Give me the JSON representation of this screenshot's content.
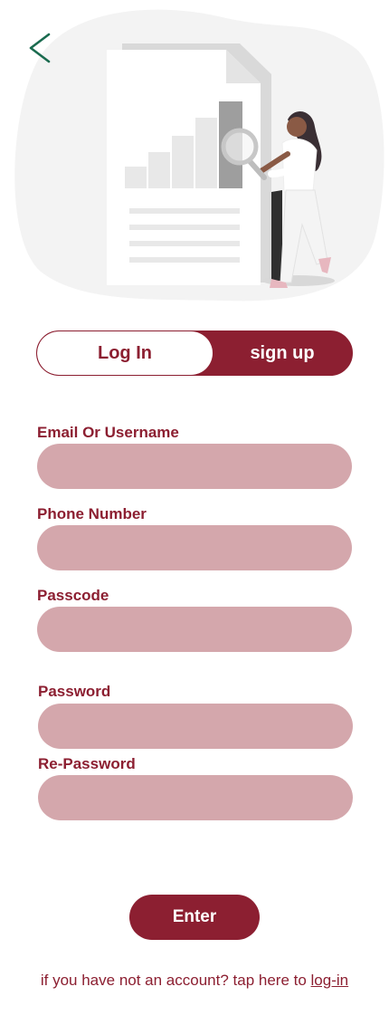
{
  "tabs": {
    "login": "Log In",
    "signup": "sign up",
    "active": "signup"
  },
  "fields": [
    {
      "label": "Email Or Username",
      "value": "",
      "placeholder": ""
    },
    {
      "label": "Phone Number",
      "value": "",
      "placeholder": ""
    },
    {
      "label": "Passcode",
      "value": "",
      "placeholder": ""
    },
    {
      "label": "Password",
      "value": "",
      "placeholder": ""
    },
    {
      "label": "Re-Password",
      "value": "",
      "placeholder": ""
    }
  ],
  "enter_label": "Enter",
  "footer": {
    "text": "if you have not an account? tap here to ",
    "link": "log-in"
  },
  "icons": {
    "back": "back-arrow-icon",
    "hero": "report-analysis-illustration"
  },
  "colors": {
    "brand": "#8c1f31",
    "input_bg": "#d4a7ac",
    "back_arrow": "#1a6b4f"
  }
}
